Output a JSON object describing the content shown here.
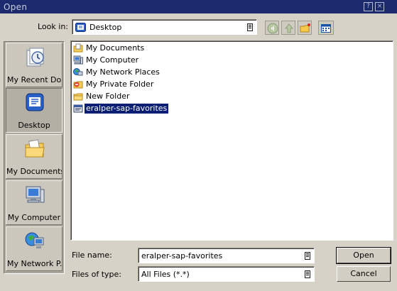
{
  "window": {
    "title": "Open",
    "help_label": "?",
    "close_label": "×"
  },
  "lookin": {
    "label": "Look in:",
    "value": "Desktop"
  },
  "places": [
    {
      "label": "My Recent Do..."
    },
    {
      "label": "Desktop"
    },
    {
      "label": "My Documents"
    },
    {
      "label": "My Computer"
    },
    {
      "label": "My Network P..."
    }
  ],
  "files": [
    {
      "label": "My Documents",
      "icon": "documents-folder-icon"
    },
    {
      "label": "My Computer",
      "icon": "computer-icon"
    },
    {
      "label": "My Network Places",
      "icon": "network-places-icon"
    },
    {
      "label": "My Private Folder",
      "icon": "private-folder-icon"
    },
    {
      "label": "New Folder",
      "icon": "folder-icon"
    },
    {
      "label": "eralper-sap-favorites",
      "icon": "sap-file-icon",
      "selected": true
    }
  ],
  "filename": {
    "label": "File name:",
    "value": "eralper-sap-favorites"
  },
  "filetype": {
    "label": "Files of type:",
    "value": "All Files (*.*)"
  },
  "buttons": {
    "open": "Open",
    "cancel": "Cancel"
  },
  "colors": {
    "titlebar": "#1c2a6e",
    "selection": "#0a1f73",
    "dialog_bg": "#d6d2c7"
  }
}
